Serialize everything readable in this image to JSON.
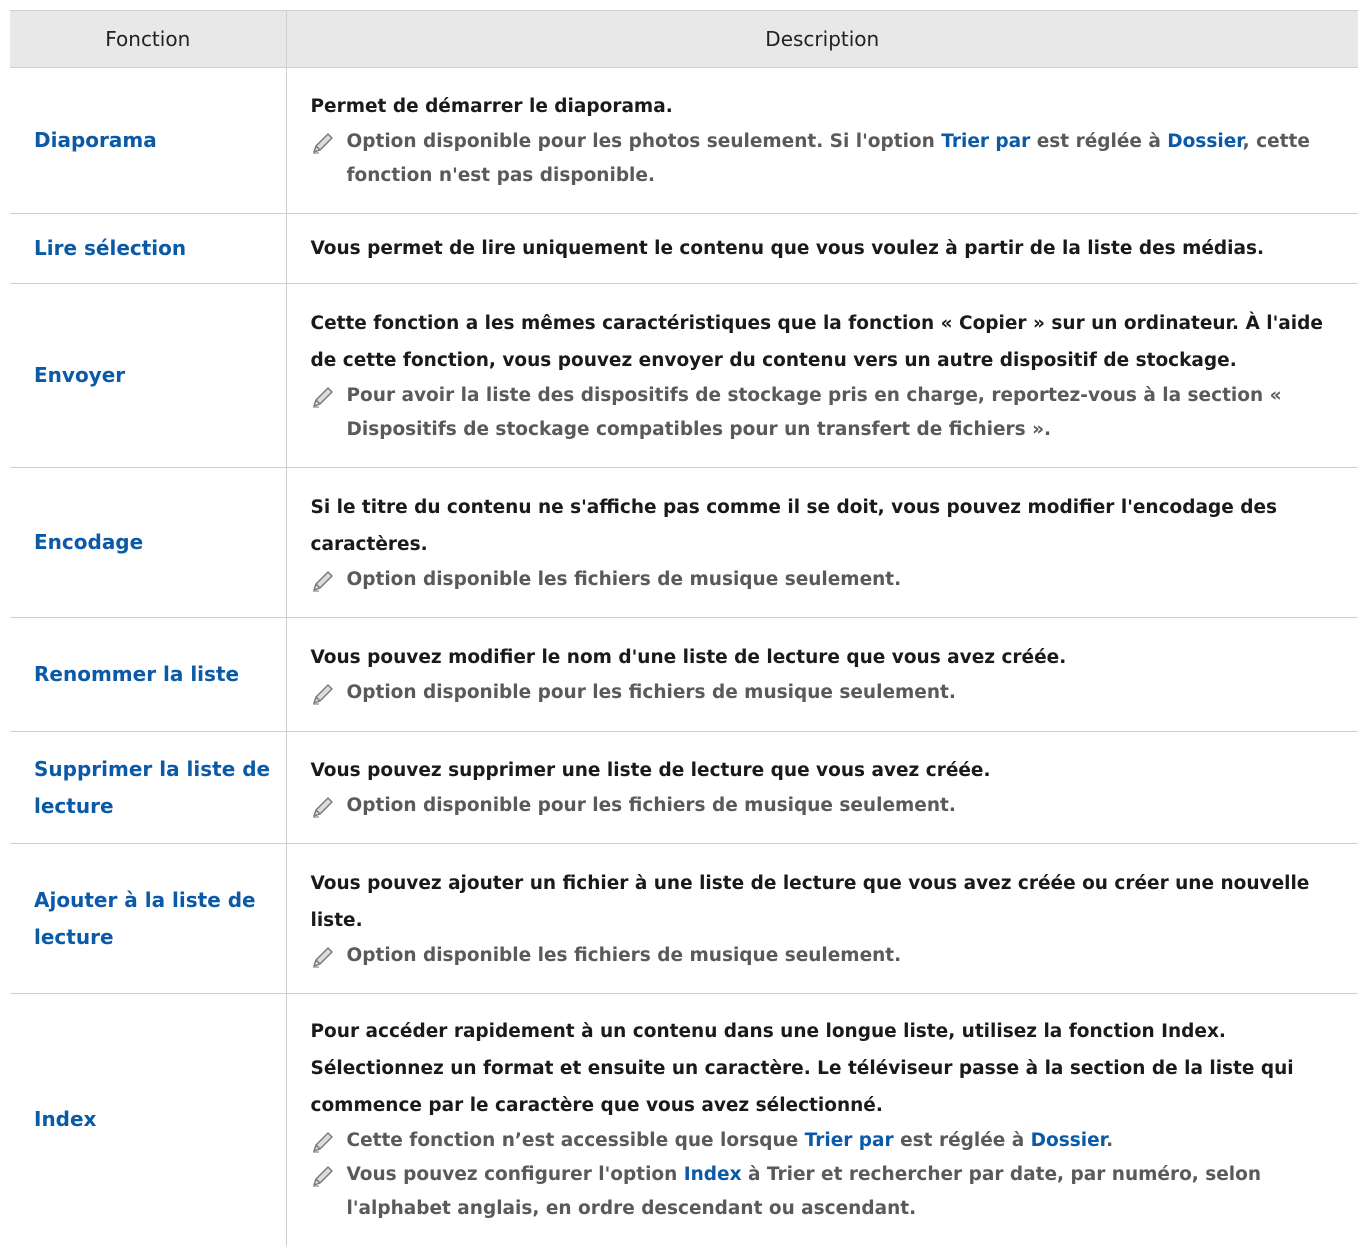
{
  "table": {
    "header": {
      "fonction": "Fonction",
      "description": "Description"
    },
    "rows": [
      {
        "fonction": "Diaporama",
        "description": "Permet de démarrer le diaporama.",
        "note": {
          "p1": "Option disponible pour les photos seulement. Si l'option ",
          "h1": "Trier par",
          "p2": " est réglée à ",
          "h2": "Dossier",
          "p3": ", cette fonction n'est pas disponible."
        }
      },
      {
        "fonction": "Lire sélection",
        "description": "Vous permet de lire uniquement le contenu que vous voulez à partir de la liste des médias."
      },
      {
        "fonction": "Envoyer",
        "description": "Cette fonction a les mêmes caractéristiques que la fonction « Copier » sur un ordinateur. À l'aide de cette fonction, vous pouvez envoyer du contenu vers un autre dispositif de stockage.",
        "note": "Pour avoir la liste des dispositifs de stockage pris en charge, reportez-vous à la section « Dispositifs de stockage compatibles pour un transfert de fichiers »."
      },
      {
        "fonction": "Encodage",
        "description": "Si le titre du contenu ne s'affiche pas comme il se doit, vous pouvez modifier l'encodage des caractères.",
        "note": "Option disponible les fichiers de musique seulement."
      },
      {
        "fonction": "Renommer la liste",
        "description": "Vous pouvez modifier le nom d'une liste de lecture que vous avez créée.",
        "note": "Option disponible pour les fichiers de musique seulement."
      },
      {
        "fonction": "Supprimer la liste de lecture",
        "description": "Vous pouvez supprimer une liste de lecture que vous avez créée.",
        "note": "Option disponible pour les fichiers de musique seulement."
      },
      {
        "fonction": "Ajouter à la liste de lecture",
        "description": "Vous pouvez ajouter un fichier à une liste de lecture que vous avez créée ou créer une nouvelle liste.",
        "note": "Option disponible les fichiers de musique seulement."
      },
      {
        "fonction": "Index",
        "description": "Pour accéder rapidement à un contenu dans une longue liste, utilisez la fonction Index. Sélectionnez un format et ensuite un caractère. Le téléviseur passe à la section de la liste qui commence par le caractère que vous avez sélectionné.",
        "note1": {
          "p1": "Cette fonction n’est accessible que lorsque ",
          "h1": "Trier par",
          "p2": " est réglée à ",
          "h2": "Dossier",
          "p3": "."
        },
        "note2": {
          "p1": "Vous pouvez configurer l'option ",
          "h1": "Index",
          "p2": " à Trier et rechercher par date, par numéro, selon l'alphabet anglais, en ordre descendant ou ascendant."
        }
      }
    ]
  },
  "icons": {
    "note_icon": "pencil-icon"
  },
  "colors": {
    "link_blue": "#0b5aa8",
    "header_bg": "#e8e8e8",
    "note_gray": "#5a5a5a"
  }
}
